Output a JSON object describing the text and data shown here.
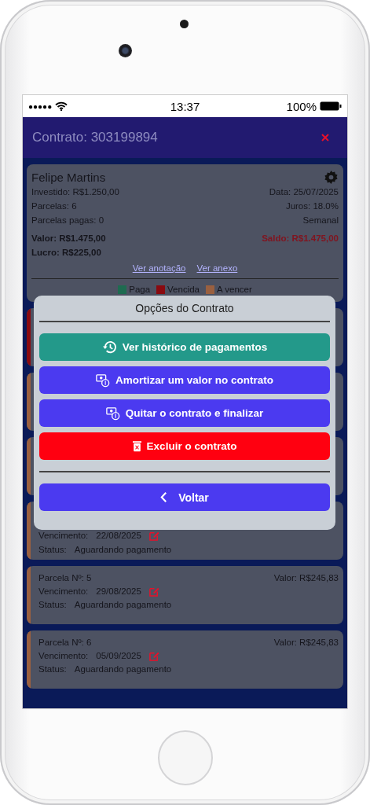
{
  "status_bar": {
    "signal": "●●●●●",
    "time": "13:37",
    "battery": "100%"
  },
  "header": {
    "title": "Contrato: 303199894"
  },
  "contract": {
    "client": "Felipe Martins",
    "left": [
      "Investido: R$1.250,00",
      "Parcelas: 6",
      "Parcelas pagas: 0"
    ],
    "right": [
      "Data: 25/07/2025",
      "Juros: 18.0%",
      "Semanal"
    ],
    "valor": "Valor: R$1.475,00",
    "lucro": "Lucro: R$225,00",
    "saldo": "Saldo: R$1.475,00",
    "links": [
      "Ver anotação",
      "Ver anexo"
    ]
  },
  "legend": [
    {
      "label": "Paga",
      "color": "#1e6b50"
    },
    {
      "label": "Vencida",
      "color": "#8a0a10"
    },
    {
      "label": "A vencer",
      "color": "#9a6040"
    }
  ],
  "installments": [
    {
      "color": "#8a0a10"
    },
    {
      "color": "#9a6040"
    },
    {
      "color": "#9a6040"
    },
    {
      "color": "#9a6040",
      "due_label": "Vencimento:",
      "due": "22/08/2025",
      "status_label": "Status:",
      "status": "Aguardando pagamento"
    },
    {
      "color": "#9a6040",
      "number": "Parcela Nº: 5",
      "value": "Valor: R$245,83",
      "due_label": "Vencimento:",
      "due": "29/08/2025",
      "status_label": "Status:",
      "status": "Aguardando pagamento"
    },
    {
      "color": "#9a6040",
      "number": "Parcela Nº: 6",
      "value": "Valor: R$245,83",
      "due_label": "Vencimento:",
      "due": "05/09/2025",
      "status_label": "Status:",
      "status": "Aguardando pagamento"
    }
  ],
  "modal": {
    "title": "Opções do Contrato",
    "actions": [
      {
        "kind": "history",
        "label": "Ver histórico de pagamentos"
      },
      {
        "kind": "amortize",
        "label": "Amortizar um valor no contrato"
      },
      {
        "kind": "settle",
        "label": "Quitar o contrato e finalizar"
      },
      {
        "kind": "delete",
        "label": "Excluir o contrato"
      }
    ],
    "back": "Voltar"
  }
}
